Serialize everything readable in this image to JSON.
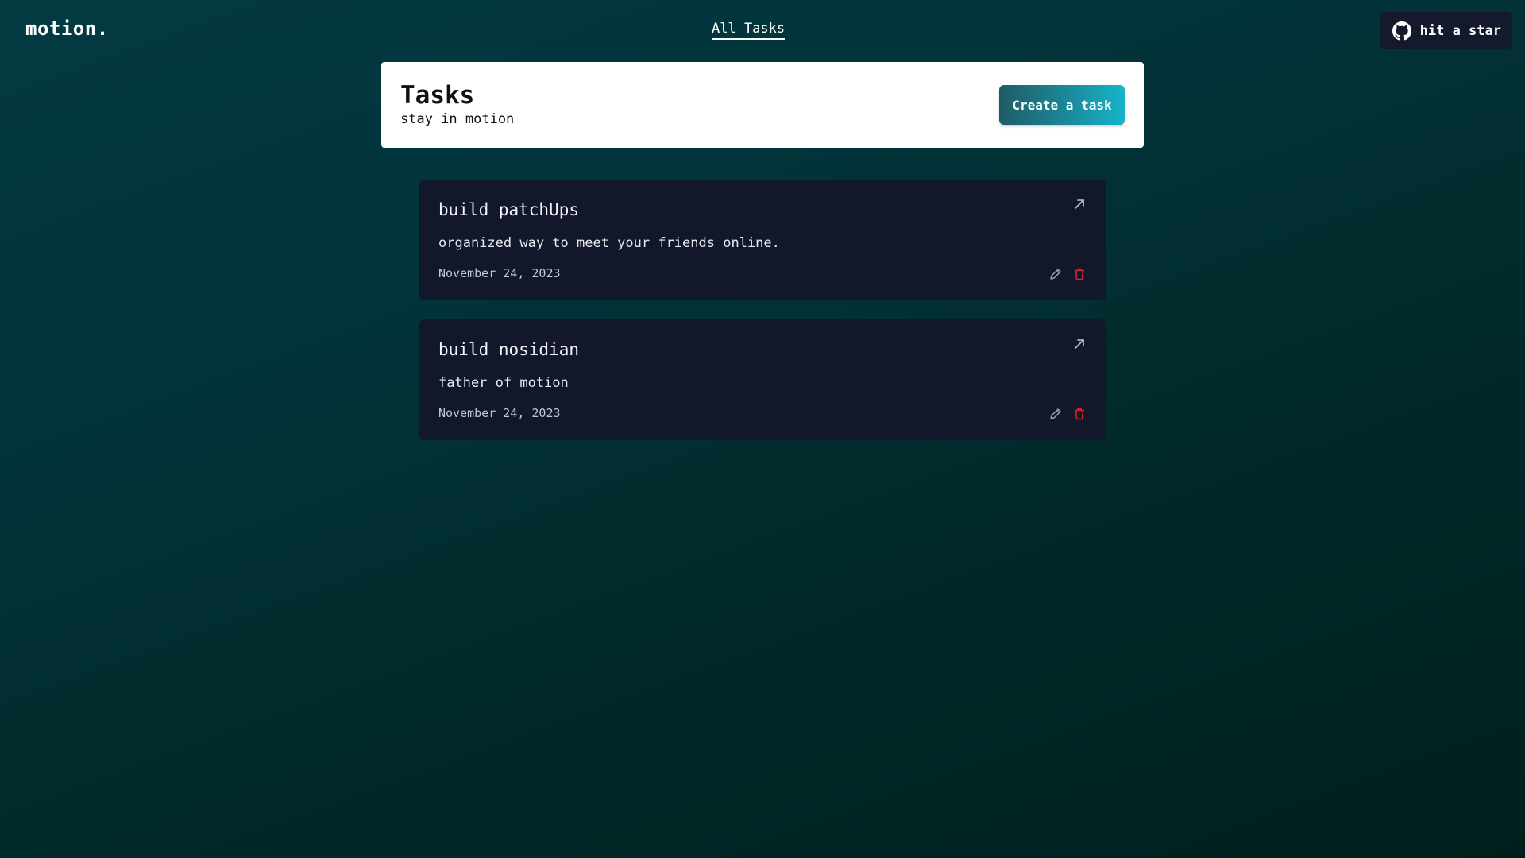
{
  "topbar": {
    "logo": "motion.",
    "nav_link": "All Tasks",
    "star_button": {
      "label": "hit a star",
      "icon": "github-icon"
    }
  },
  "header": {
    "title": "Tasks",
    "subtitle": "stay in motion",
    "create_button": "Create a task"
  },
  "tasks": [
    {
      "title": "build patchUps",
      "description": "organized way to meet your friends online.",
      "date": "November 24, 2023"
    },
    {
      "title": "build nosidian",
      "description": "father of motion",
      "date": "November 24, 2023"
    }
  ],
  "colors": {
    "background_top": "#033a42",
    "background_bottom": "#001f1c",
    "card_bg": "#12172a",
    "accent_start": "#205c66",
    "accent_end": "#17b5c9",
    "delete": "#d3242f"
  }
}
